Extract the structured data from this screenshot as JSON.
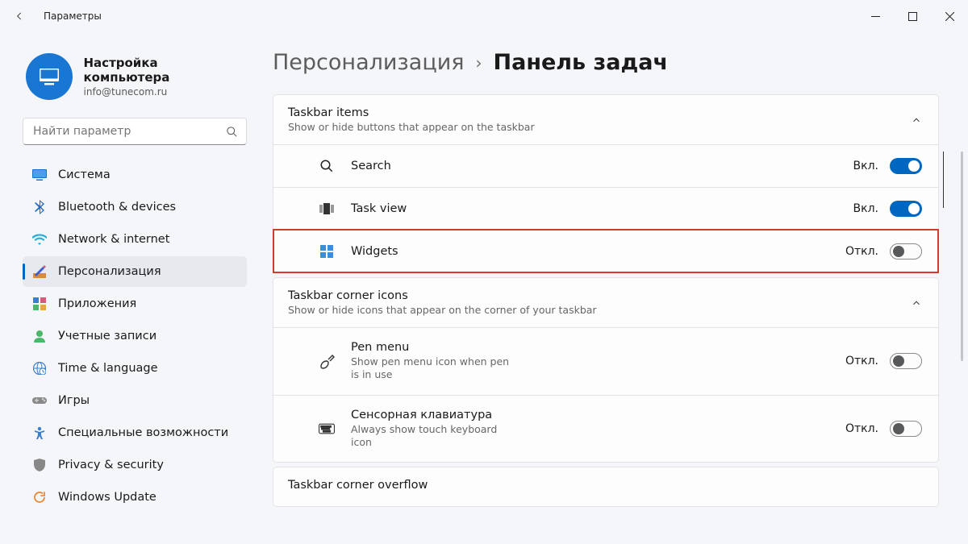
{
  "window": {
    "title": "Параметры"
  },
  "profile": {
    "name": "Настройка компьютера",
    "email": "info@tunecom.ru"
  },
  "search": {
    "placeholder": "Найти параметр"
  },
  "nav": [
    {
      "id": "system",
      "label": "Система"
    },
    {
      "id": "bluetooth",
      "label": "Bluetooth & devices"
    },
    {
      "id": "network",
      "label": "Network & internet"
    },
    {
      "id": "personalization",
      "label": "Персонализация",
      "active": true
    },
    {
      "id": "apps",
      "label": "Приложения"
    },
    {
      "id": "accounts",
      "label": "Учетные записи"
    },
    {
      "id": "time",
      "label": "Time & language"
    },
    {
      "id": "gaming",
      "label": "Игры"
    },
    {
      "id": "accessibility",
      "label": "Специальные возможности"
    },
    {
      "id": "privacy",
      "label": "Privacy & security"
    },
    {
      "id": "update",
      "label": "Windows Update"
    }
  ],
  "breadcrumb": {
    "parent": "Персонализация",
    "sep": "›",
    "current": "Панель задач"
  },
  "sections": {
    "taskbar_items": {
      "title": "Taskbar items",
      "sub": "Show or hide buttons that appear on the taskbar",
      "rows": [
        {
          "id": "search",
          "label": "Search",
          "state": "Вкл.",
          "on": true
        },
        {
          "id": "taskview",
          "label": "Task view",
          "state": "Вкл.",
          "on": true
        },
        {
          "id": "widgets",
          "label": "Widgets",
          "state": "Откл.",
          "on": false,
          "highlight": true
        }
      ]
    },
    "corner_icons": {
      "title": "Taskbar corner icons",
      "sub": "Show or hide icons that appear on the corner of your taskbar",
      "rows": [
        {
          "id": "pen",
          "label": "Pen menu",
          "sub": "Show pen menu icon when pen is in use",
          "state": "Откл.",
          "on": false
        },
        {
          "id": "touch",
          "label": "Сенсорная клавиатура",
          "sub": "Always show touch keyboard icon",
          "state": "Откл.",
          "on": false
        }
      ]
    },
    "overflow": {
      "title": "Taskbar corner overflow"
    }
  }
}
